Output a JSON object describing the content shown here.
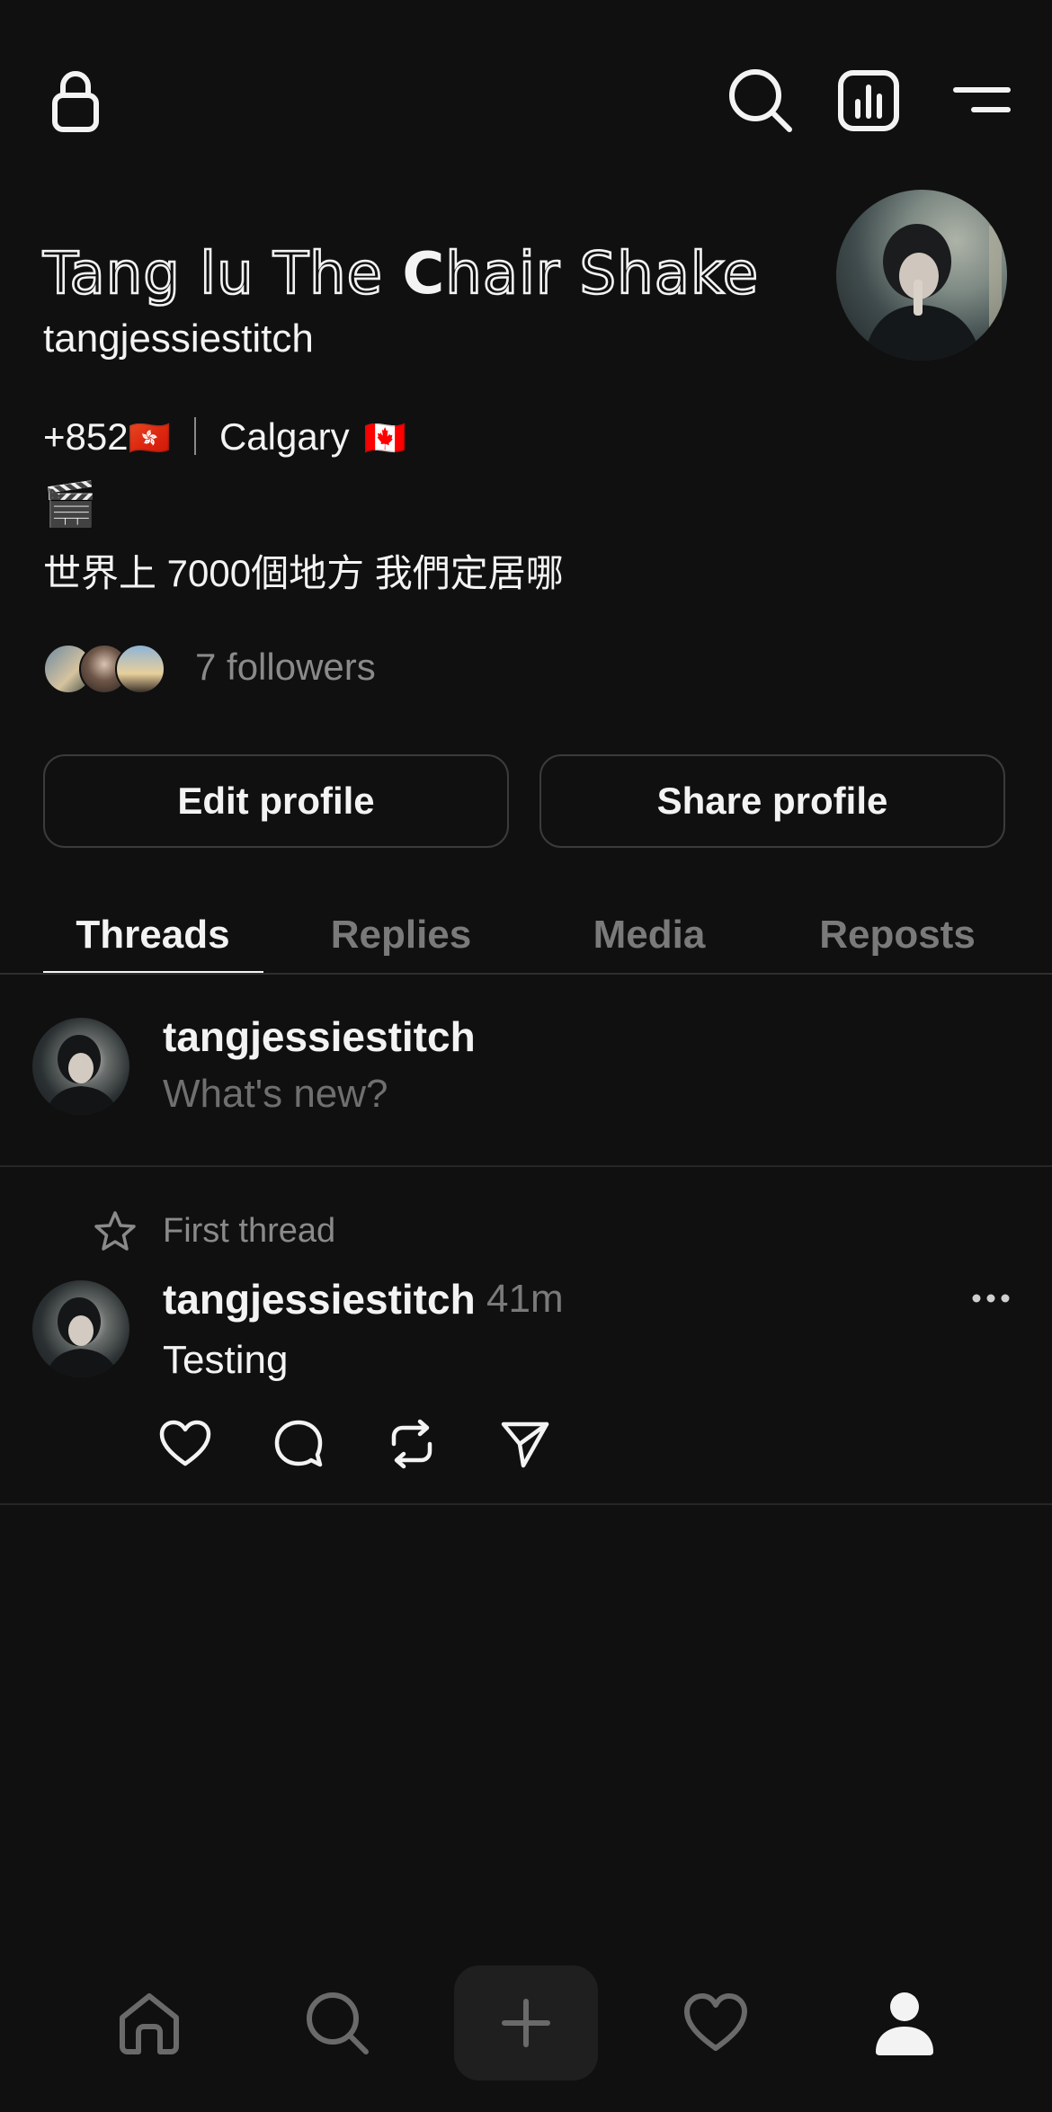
{
  "header": {
    "icons": [
      "lock-icon",
      "search-icon",
      "insights-icon",
      "menu-icon"
    ]
  },
  "profile": {
    "display_name_part1": "Tang lu The ",
    "display_name_bold": "C",
    "display_name_part2": "hair Shake",
    "username": "tangjessiestitch",
    "bio_phone": "+852",
    "bio_flag_hk": "🇭🇰",
    "bio_city": "Calgary",
    "bio_flag_ca": "🇨🇦",
    "bio_emoji": "🎬",
    "bio_text": "世界上 7000個地方 我們定居哪",
    "followers": "7 followers"
  },
  "actions": {
    "edit_profile": "Edit profile",
    "share_profile": "Share profile"
  },
  "tabs": [
    {
      "label": "Threads",
      "active": true
    },
    {
      "label": "Replies",
      "active": false
    },
    {
      "label": "Media",
      "active": false
    },
    {
      "label": "Reposts",
      "active": false
    }
  ],
  "composer": {
    "username": "tangjessiestitch",
    "placeholder": "What's new?"
  },
  "thread": {
    "pinned_label": "First thread",
    "username": "tangjessiestitch",
    "time_ago": "41m",
    "text": "Testing"
  },
  "bottom_nav": [
    "home-icon",
    "search-icon",
    "compose-plus-icon",
    "activity-heart-icon",
    "profile-icon"
  ],
  "colors": {
    "background": "#101010",
    "text": "#f3f3f3",
    "muted": "#7a7a7a",
    "border": "#3b3b3b"
  }
}
